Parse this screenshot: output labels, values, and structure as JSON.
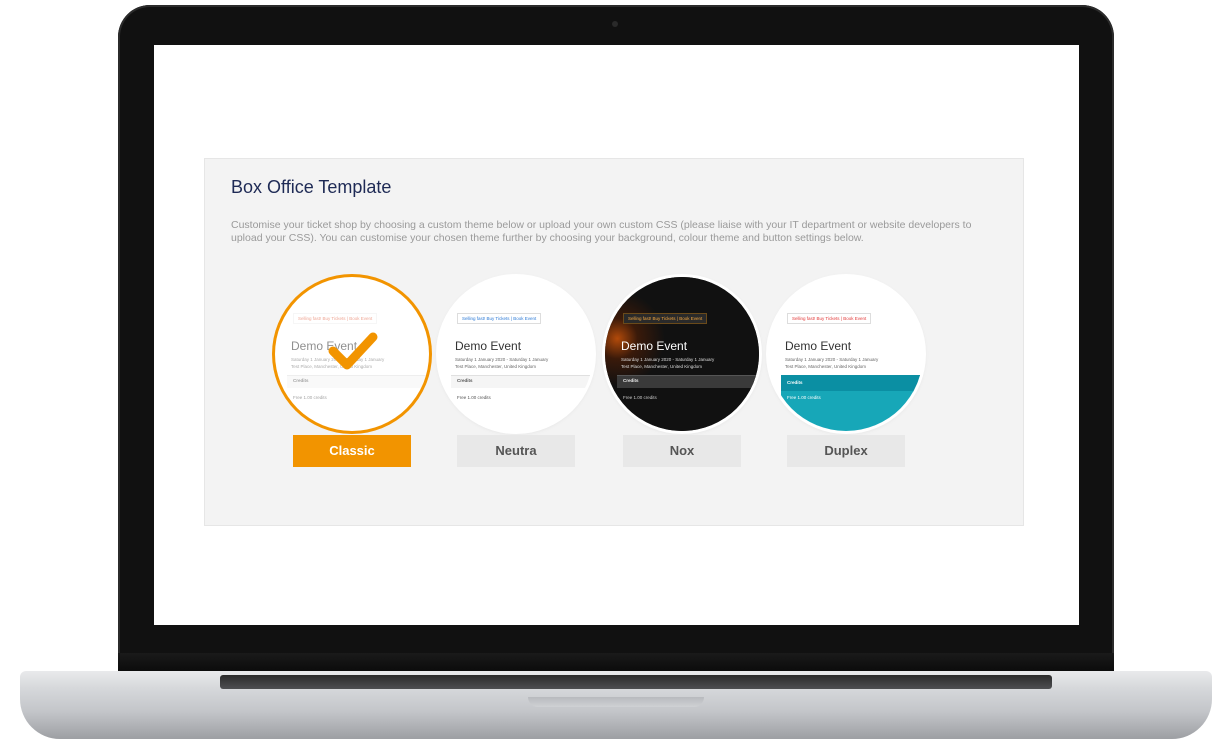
{
  "panel": {
    "title": "Box Office Template",
    "description": "Customise your ticket shop by choosing a custom theme below or upload your own custom CSS (please liaise with your IT department or website developers to upload your CSS). You can customise your chosen theme further by choosing your background, colour theme and button settings below."
  },
  "themes": [
    {
      "label": "Classic",
      "selected": true,
      "preview": {
        "badge": "Selling fast! Buy Tickets | Book Event",
        "title": "Demo Event",
        "date": "Saturday 1 January 2020 - Saturday 1 January",
        "venue": "Test Place, Manchester, United Kingdom",
        "bar": "Credits",
        "price": "Free  1.00 credits"
      }
    },
    {
      "label": "Neutra",
      "selected": false,
      "preview": {
        "badge": "Selling fast! Buy Tickets | Book Event",
        "title": "Demo Event",
        "date": "Saturday 1 January 2020 - Saturday 1 January",
        "venue": "Test Place, Manchester, United Kingdom",
        "bar": "Credits",
        "price": "Free  1.00 credits"
      }
    },
    {
      "label": "Nox",
      "selected": false,
      "preview": {
        "badge": "Selling fast! Buy Tickets | Book Event",
        "title": "Demo Event",
        "date": "Saturday 1 January 2020 - Saturday 1 January",
        "venue": "Test Place, Manchester, United Kingdom",
        "bar": "Credits",
        "price": "Free  1.00 credits"
      }
    },
    {
      "label": "Duplex",
      "selected": false,
      "preview": {
        "badge": "Selling fast! Buy Tickets | Book Event",
        "title": "Demo Event",
        "date": "Saturday 1 January 2020 - Saturday 1 January",
        "venue": "Test Place, Manchester, United Kingdom",
        "bar": "Credits",
        "price": "Free  1.00 credits"
      }
    }
  ],
  "colors": {
    "accent": "#f29400",
    "title": "#1e2a55",
    "nox_background": "#111111",
    "duplex_teal": "#0b8fa3"
  },
  "icons": {
    "selected_marker": "check-icon"
  }
}
